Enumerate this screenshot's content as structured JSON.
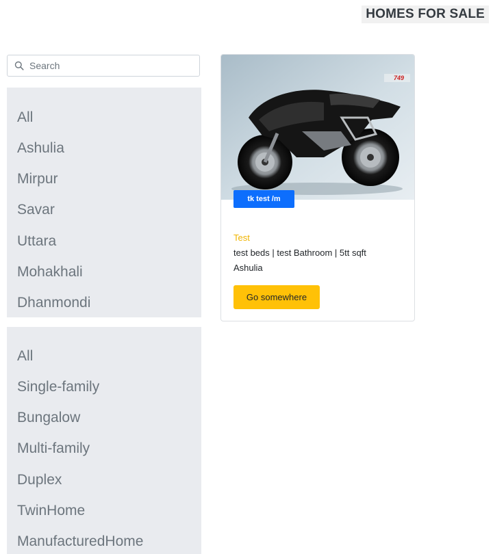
{
  "header": {
    "title": "HOMES FOR SALE"
  },
  "search": {
    "placeholder": "Search",
    "value": "",
    "icon": "search-icon"
  },
  "location_filters": {
    "items": [
      "All",
      "Ashulia",
      "Mirpur",
      "Savar",
      "Uttara",
      "Mohakhali",
      "Dhanmondi"
    ]
  },
  "type_filters": {
    "items": [
      "All",
      "Single-family",
      "Bungalow",
      "Multi-family",
      "Duplex",
      "TwinHome",
      "ManufacturedHome"
    ]
  },
  "listing": {
    "image_text": "749",
    "price_badge": "tk test /m",
    "title": "Test",
    "details": "test beds | test Bathroom | 5tt sqft",
    "location": "Ashulia",
    "button_label": "Go somewhere"
  },
  "colors": {
    "panel_bg": "#e9ebef",
    "badge_bg": "#0d6efd",
    "button_bg": "#ffc107",
    "title_text": "#f0b400"
  }
}
